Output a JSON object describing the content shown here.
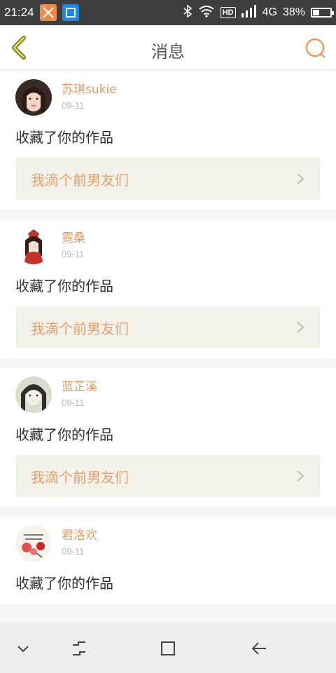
{
  "status_bar": {
    "time": "21:24",
    "network": "4G",
    "hd_label": "HD",
    "battery_text": "38%",
    "battery_level": 0.38,
    "icons": [
      "bluetooth-icon",
      "wifi-icon",
      "signal-icon",
      "battery-icon"
    ]
  },
  "header": {
    "title": "消息",
    "back_icon": "chevron-left-icon",
    "search_icon": "search-icon",
    "accent_color": "#e89a5e"
  },
  "messages": [
    {
      "username": "苏琪sukie",
      "date": "09-11",
      "action": "收藏了你的作品",
      "work_title": "我滴个前男友们"
    },
    {
      "username": "霓桑",
      "date": "09-11",
      "action": "收藏了你的作品",
      "work_title": "我滴个前男友们"
    },
    {
      "username": "蓝芷溪",
      "date": "09-11",
      "action": "收藏了你的作品",
      "work_title": "我滴个前男友们"
    },
    {
      "username": "君洛欢",
      "date": "09-11",
      "action": "收藏了你的作品",
      "work_title": ""
    }
  ],
  "nav_bar": {
    "icons": [
      "chevron-down-icon",
      "recent-apps-icon",
      "home-icon",
      "back-arrow-icon"
    ]
  }
}
